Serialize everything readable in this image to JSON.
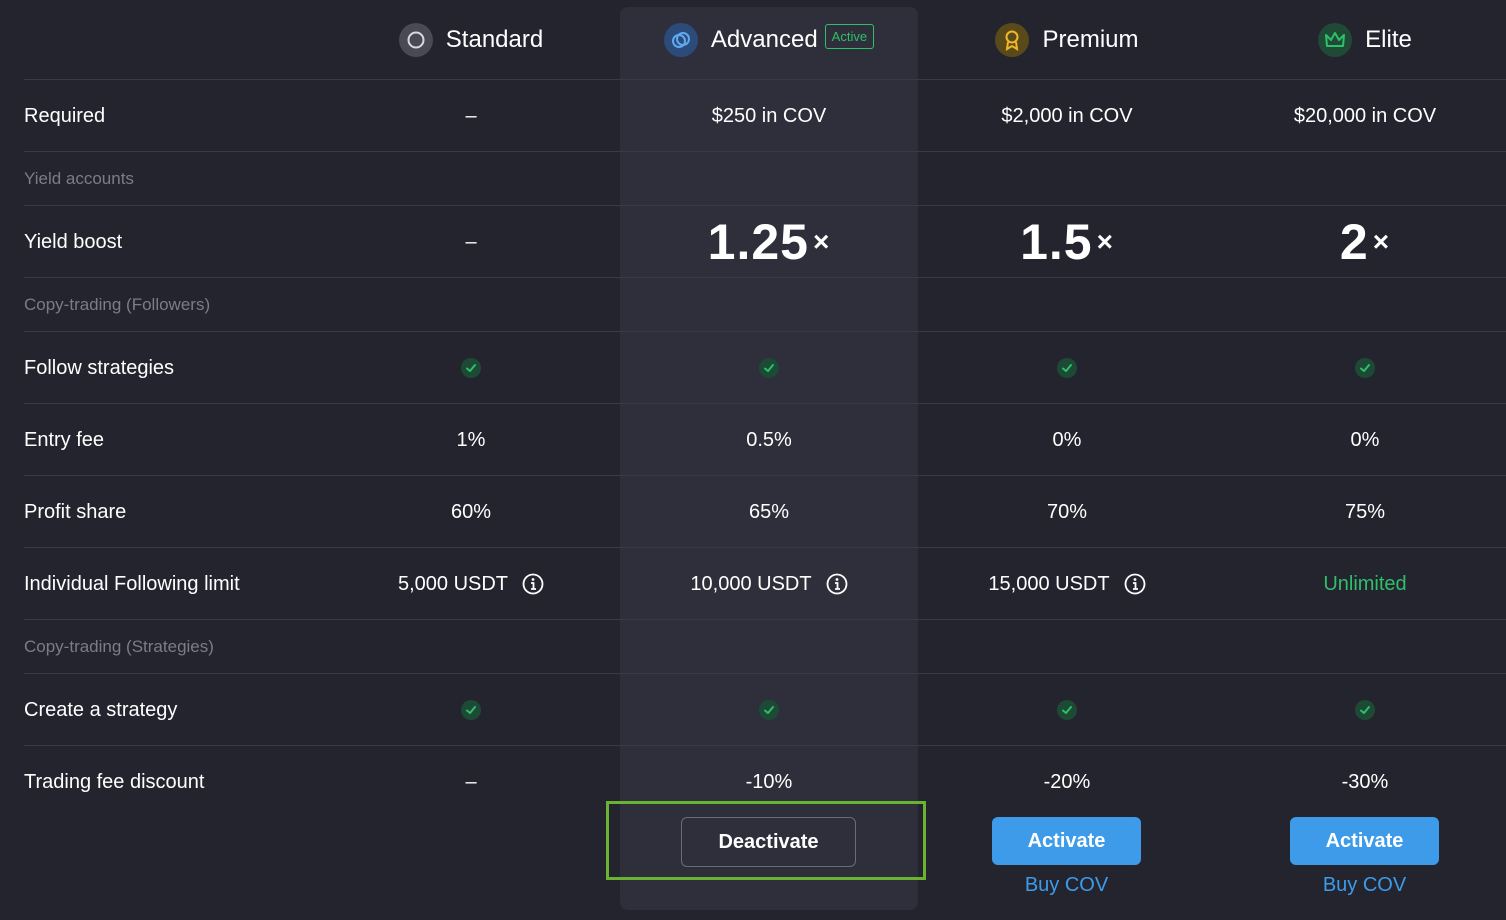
{
  "tiers": [
    {
      "name": "Standard",
      "icon": "circle-ring-icon",
      "color": "#5a5a66"
    },
    {
      "name": "Advanced",
      "icon": "linked-rings-icon",
      "color": "#2b4b7a",
      "badge": "Active"
    },
    {
      "name": "Premium",
      "icon": "medal-icon",
      "color": "#5a4a1a"
    },
    {
      "name": "Elite",
      "icon": "crown-icon",
      "color": "#1f4a35"
    }
  ],
  "rows": {
    "required": {
      "label": "Required",
      "values": [
        "–",
        "$250 in COV",
        "$2,000 in COV",
        "$20,000 in COV"
      ]
    },
    "section_yield": {
      "label": "Yield accounts"
    },
    "yield_boost": {
      "label": "Yield boost",
      "standard": "–",
      "values": [
        "1.25",
        "1.5",
        "2"
      ],
      "suffix": "×"
    },
    "section_followers": {
      "label": "Copy-trading (Followers)"
    },
    "follow_strategies": {
      "label": "Follow strategies",
      "values": [
        true,
        true,
        true,
        true
      ]
    },
    "entry_fee": {
      "label": "Entry fee",
      "values": [
        "1%",
        "0.5%",
        "0%",
        "0%"
      ]
    },
    "profit_share": {
      "label": "Profit share",
      "values": [
        "60%",
        "65%",
        "70%",
        "75%"
      ]
    },
    "following_limit": {
      "label": "Individual Following limit",
      "values": [
        "5,000 USDT",
        "10,000 USDT",
        "15,000 USDT",
        "Unlimited"
      ]
    },
    "section_strategies": {
      "label": "Copy-trading (Strategies)"
    },
    "create_strategy": {
      "label": "Create a strategy",
      "values": [
        true,
        true,
        true,
        true
      ]
    },
    "trading_fee": {
      "label": "Trading fee discount",
      "values": [
        "–",
        "-10%",
        "-20%",
        "-30%"
      ]
    }
  },
  "actions": {
    "deactivate": "Deactivate",
    "activate": "Activate",
    "buy": "Buy COV"
  },
  "colors": {
    "accent": "#3d9be9",
    "positive": "#2fbf6a",
    "focus_outline": "#6ab232"
  }
}
